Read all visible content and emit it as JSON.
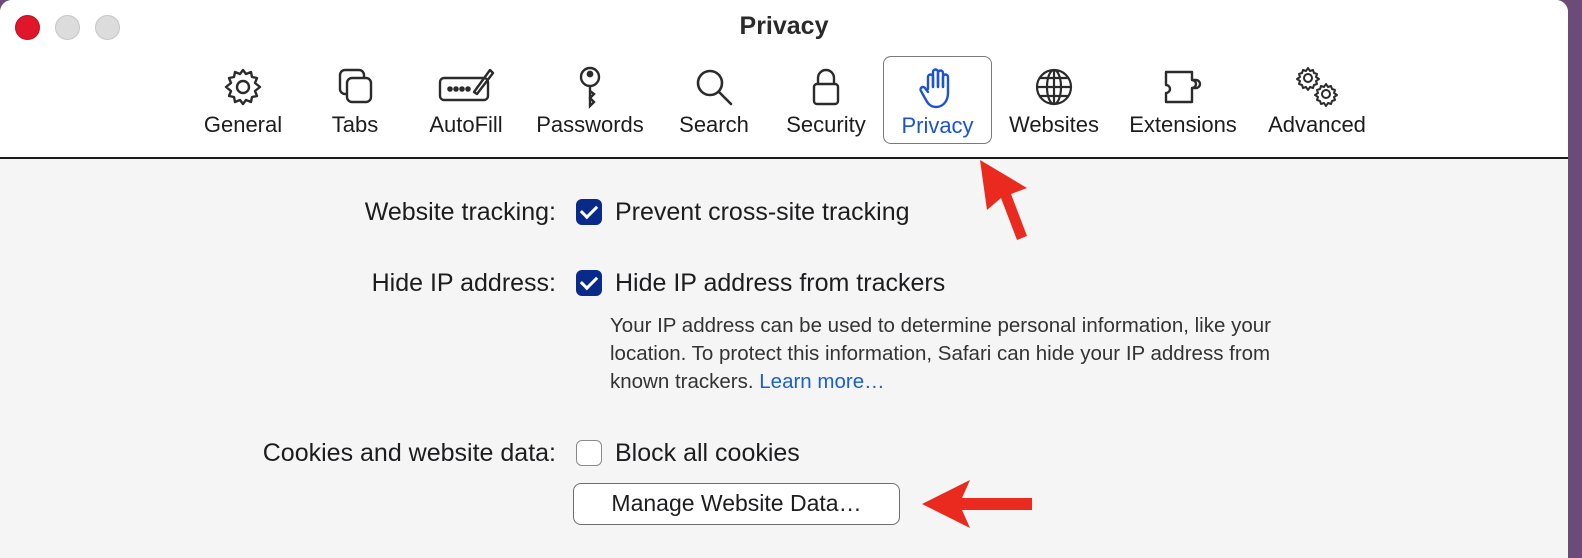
{
  "window": {
    "title": "Privacy"
  },
  "toolbar": {
    "items": [
      {
        "label": "General",
        "icon": "gear-icon"
      },
      {
        "label": "Tabs",
        "icon": "tabs-icon"
      },
      {
        "label": "AutoFill",
        "icon": "autofill-icon"
      },
      {
        "label": "Passwords",
        "icon": "key-icon"
      },
      {
        "label": "Search",
        "icon": "magnifier-icon"
      },
      {
        "label": "Security",
        "icon": "lock-icon"
      },
      {
        "label": "Privacy",
        "icon": "hand-icon",
        "selected": true
      },
      {
        "label": "Websites",
        "icon": "globe-icon"
      },
      {
        "label": "Extensions",
        "icon": "puzzle-icon"
      },
      {
        "label": "Advanced",
        "icon": "gears-icon"
      }
    ]
  },
  "settings": {
    "tracking": {
      "label": "Website tracking:",
      "option": "Prevent cross-site tracking",
      "checked": true
    },
    "hide_ip": {
      "label": "Hide IP address:",
      "option": "Hide IP address from trackers",
      "checked": true,
      "description": "Your IP address can be used to determine personal information, like your location. To protect this information, Safari can hide your IP address from known trackers.",
      "link": "Learn more…"
    },
    "cookies": {
      "label": "Cookies and website data:",
      "option": "Block all cookies",
      "checked": false,
      "button": "Manage Website Data…"
    }
  },
  "colors": {
    "accent": "#1a53d6",
    "checkbox": "#0a2a8a",
    "close": "#e0162b",
    "annotation": "#ea2a1f"
  }
}
